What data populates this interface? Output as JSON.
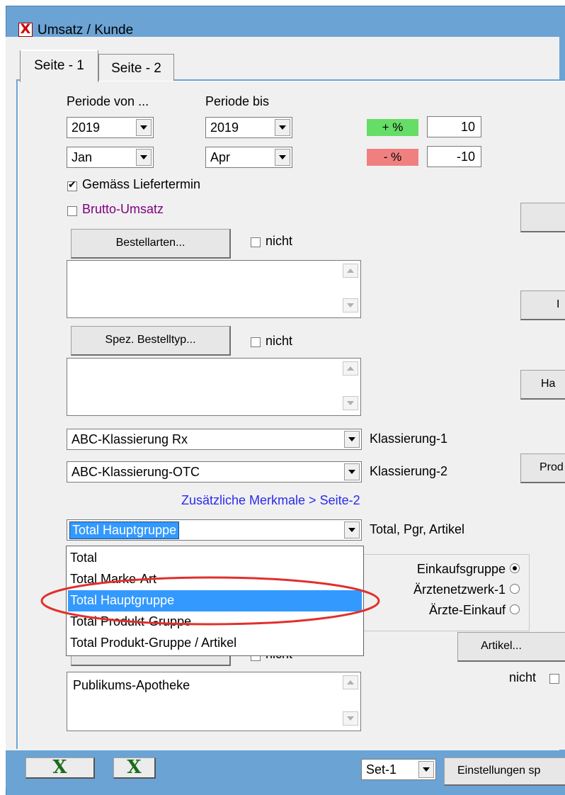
{
  "window": {
    "title": "Umsatz / Kunde",
    "icon": "close-x-icon",
    "icon_glyph": "X"
  },
  "tabs": [
    {
      "label": "Seite - 1",
      "active": true
    },
    {
      "label": "Seite - 2",
      "active": false
    }
  ],
  "periode_von": {
    "label": "Periode von ...",
    "year": "2019",
    "month": "Jan"
  },
  "periode_bis": {
    "label": "Periode bis",
    "year": "2019",
    "month": "Apr"
  },
  "percent": {
    "plus_label": "+ %",
    "plus_value": "10",
    "plus_color": "#66dd66",
    "minus_label": "- %",
    "minus_value": "-10",
    "minus_color": "#f08080"
  },
  "checkboxes": {
    "liefertermin": {
      "label": "Gemäss Liefertermin",
      "checked": true
    },
    "brutto": {
      "label": "Brutto-Umsatz",
      "checked": false,
      "color": "#800080"
    }
  },
  "bestellarten": {
    "button": "Bestellarten...",
    "nicht": "nicht"
  },
  "spez": {
    "button": "Spez. Bestelltyp...",
    "nicht": "nicht"
  },
  "klassierung1": {
    "value": "ABC-Klassierung Rx",
    "label": "Klassierung-1"
  },
  "klassierung2": {
    "value": "ABC-Klassierung-OTC",
    "label": "Klassierung-2"
  },
  "link": {
    "text": "Zusätzliche Merkmale > Seite-2",
    "color": "#0000ee"
  },
  "total_combo": {
    "value": "Total Hauptgruppe",
    "label": "Total, Pgr, Artikel"
  },
  "dropdown_options": [
    {
      "text": "Total",
      "selected": false
    },
    {
      "text": "Total Marke-Art",
      "selected": false
    },
    {
      "text": "Total Hauptgruppe",
      "selected": true
    },
    {
      "text": "Total Produkt-Gruppe",
      "selected": false
    },
    {
      "text": "Total Produkt-Gruppe / Artikel",
      "selected": false
    }
  ],
  "radio_options": [
    {
      "label": "Einkaufsgruppe",
      "selected": true
    },
    {
      "label": "Ärztenetzwerk-1",
      "selected": false
    },
    {
      "label": "Ärzte-Einkauf",
      "selected": false
    }
  ],
  "partial_texts": {
    "behind_dropdown_nicht": "nicht",
    "right_btn_2": "I",
    "right_btn_3": "Ha",
    "right_btn_4": "Prod"
  },
  "artikel": {
    "button": "Artikel...",
    "nicht": "nicht"
  },
  "kunden_list": {
    "items": [
      "Publikums-Apotheke"
    ]
  },
  "footer": {
    "set_value": "Set-1",
    "settings_button": "Einstellungen sp",
    "x_icon": "excel-x-icon",
    "x_glyph": "X"
  },
  "annotation": {
    "color": "#e0302c"
  }
}
